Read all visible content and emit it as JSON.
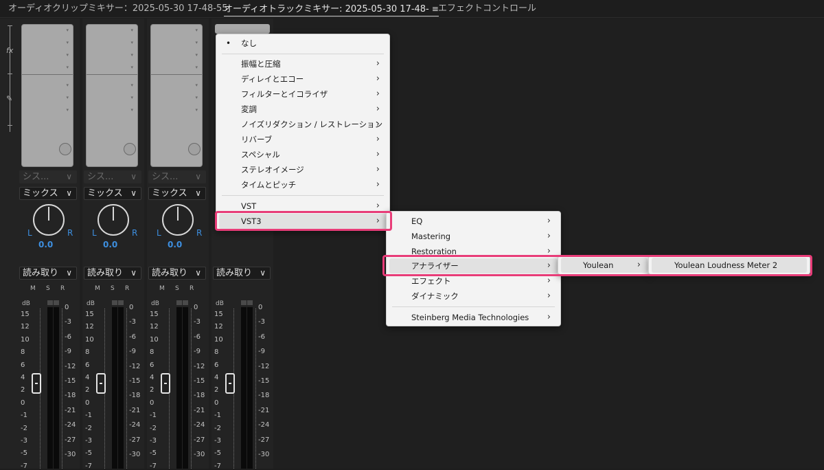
{
  "tabs": [
    {
      "label": "オーディオクリップミキサー：2025-05-30 17-48-55"
    },
    {
      "label": "オーディオトラックミキサー: 2025-05-30 17-48-",
      "menu_icon": "≡"
    },
    {
      "label": "エフェクトコントロール"
    }
  ],
  "gutter": {
    "fx_glyph": "fx",
    "pen_glyph": "✎"
  },
  "strips": [
    {
      "send": "シス...",
      "mode": "ミックス",
      "pan_left": "L",
      "pan_right": "R",
      "pan_value": "0.0",
      "automation": "読み取り",
      "m": "M",
      "s": "S",
      "r": "R"
    },
    {
      "send": "シス...",
      "mode": "ミックス",
      "pan_left": "L",
      "pan_right": "R",
      "pan_value": "0.0",
      "automation": "読み取り",
      "m": "M",
      "s": "S",
      "r": "R"
    },
    {
      "send": "シス...",
      "mode": "ミックス",
      "pan_left": "L",
      "pan_right": "R",
      "pan_value": "0.0",
      "automation": "読み取り",
      "m": "M",
      "s": "S",
      "r": "R"
    },
    {
      "automation": "読み取り"
    }
  ],
  "db_label": "dB",
  "left_scale": [
    "15",
    "12",
    "10",
    "8",
    "6",
    "4",
    "2",
    "0",
    "-1",
    "-2",
    "-3",
    "-5",
    "-7"
  ],
  "right_scale": [
    "0",
    "-3",
    "-6",
    "-9",
    "-12",
    "-15",
    "-18",
    "-21",
    "-24",
    "-27",
    "-30"
  ],
  "effects_menu": {
    "items": [
      {
        "label": "なし",
        "selected": true
      },
      {
        "label": "振幅と圧縮"
      },
      {
        "label": "ディレイとエコー"
      },
      {
        "label": "フィルターとイコライザ"
      },
      {
        "label": "変調"
      },
      {
        "label": "ノイズリダクション / レストレーション"
      },
      {
        "label": "リバーブ"
      },
      {
        "label": "スペシャル"
      },
      {
        "label": "ステレオイメージ"
      },
      {
        "label": "タイムとピッチ"
      },
      {
        "label": "VST"
      },
      {
        "label": "VST3",
        "highlighted": true
      }
    ]
  },
  "vst3_menu": {
    "items": [
      {
        "label": "EQ"
      },
      {
        "label": "Mastering"
      },
      {
        "label": "Restoration"
      },
      {
        "label": "アナライザー",
        "highlighted": true
      },
      {
        "label": "エフェクト"
      },
      {
        "label": "ダイナミック"
      },
      {
        "label": "Steinberg Media Technologies"
      }
    ]
  },
  "analyzer_menu": {
    "items": [
      {
        "label": "Youlean",
        "highlighted": true
      }
    ]
  },
  "youlean_menu": {
    "items": [
      {
        "label": "Youlean Loudness Meter 2",
        "highlighted": true
      }
    ]
  },
  "chevron": "›",
  "bullet": "•",
  "caret": "∨",
  "accent_color": "#3d8fe0",
  "highlight_color": "#e83c78"
}
